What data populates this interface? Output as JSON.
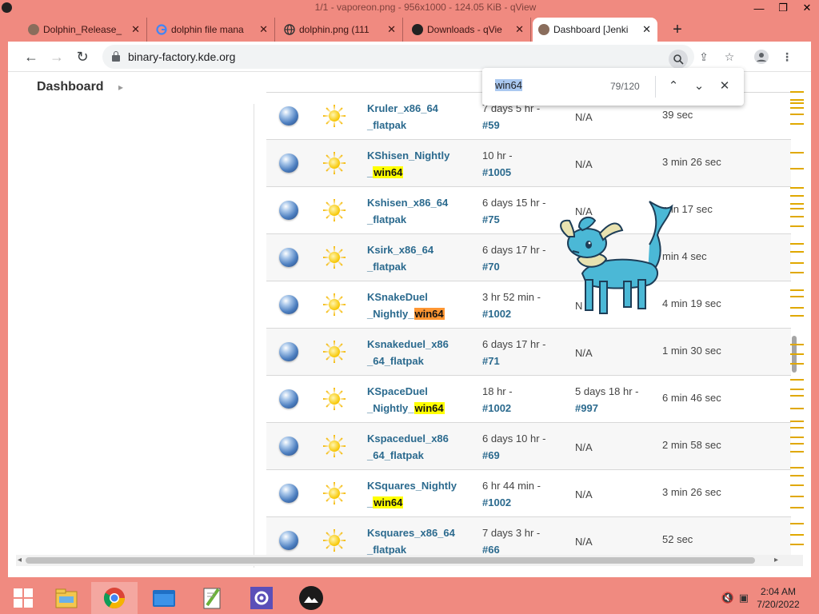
{
  "viewer": {
    "title": "1/1 - vaporeon.png - 956x1000 - 124.05 KiB - qView",
    "controls": [
      "—",
      "❐",
      "✕"
    ]
  },
  "browser": {
    "tabs": [
      {
        "label": "Dolphin_Release_",
        "icon": "avatar-icon",
        "color": "#8a6d5c",
        "close": "✕"
      },
      {
        "label": "dolphin file mana",
        "icon": "google-icon",
        "color": "#4285f4",
        "close": "✕"
      },
      {
        "label": "dolphin.png (111",
        "icon": "dolphin-icon",
        "color": "#333333",
        "close": "✕"
      },
      {
        "label": "Downloads - qVie",
        "icon": "qview-icon",
        "color": "#222222",
        "close": "✕"
      },
      {
        "label": "Dashboard [Jenki",
        "icon": "jenkins-icon",
        "color": "#8a6d5c",
        "close": "✕"
      }
    ],
    "new_tab": "+",
    "url": "binary-factory.kde.org"
  },
  "page": {
    "breadcrumb": "Dashboard",
    "breadcrumb_arrow": "▸"
  },
  "find": {
    "query": "win64",
    "count": "79/120"
  },
  "jobs": [
    {
      "name_parts": [
        [
          "Kruler_x86_64",
          ""
        ],
        [
          "_flatpak",
          ""
        ]
      ],
      "success_time": "7 days 5 hr -",
      "success_build": "#59",
      "fail": "N/A",
      "fail_build": "",
      "duration": "39 sec"
    },
    {
      "name_parts": [
        [
          "KShisen_Nightly",
          ""
        ],
        [
          "_",
          "win64"
        ]
      ],
      "success_time": "10 hr -",
      "success_build": "#1005",
      "fail": "N/A",
      "fail_build": "",
      "duration": "3 min 26 sec"
    },
    {
      "name_parts": [
        [
          "Kshisen_x86_64",
          ""
        ],
        [
          "_flatpak",
          ""
        ]
      ],
      "success_time": "6 days 15 hr -",
      "success_build": "#75",
      "fail": "N/A",
      "fail_build": "",
      "duration": "min 17 sec"
    },
    {
      "name_parts": [
        [
          "Ksirk_x86_64",
          ""
        ],
        [
          "_flatpak",
          ""
        ]
      ],
      "success_time": "6 days 17 hr -",
      "success_build": "#70",
      "fail": "",
      "fail_build": "",
      "duration": "min 4 sec"
    },
    {
      "name_parts": [
        [
          "KSnakeDuel",
          ""
        ],
        [
          "_Nightly_",
          "win64"
        ]
      ],
      "success_time": "3 hr 52 min -",
      "success_build": "#1002",
      "fail": "N",
      "fail_build": "",
      "duration": "4 min 19 sec",
      "current": true
    },
    {
      "name_parts": [
        [
          "Ksnakeduel_x86",
          ""
        ],
        [
          "_64_flatpak",
          ""
        ]
      ],
      "success_time": "6 days 17 hr -",
      "success_build": "#71",
      "fail": "N/A",
      "fail_build": "",
      "duration": "1 min 30 sec"
    },
    {
      "name_parts": [
        [
          "KSpaceDuel",
          ""
        ],
        [
          "_Nightly_",
          "win64"
        ]
      ],
      "success_time": "18 hr -",
      "success_build": "#1002",
      "fail": "5 days 18 hr -",
      "fail_build": "#997",
      "duration": "6 min 46 sec"
    },
    {
      "name_parts": [
        [
          "Kspaceduel_x86",
          ""
        ],
        [
          "_64_flatpak",
          ""
        ]
      ],
      "success_time": "6 days 10 hr -",
      "success_build": "#69",
      "fail": "N/A",
      "fail_build": "",
      "duration": "2 min 58 sec"
    },
    {
      "name_parts": [
        [
          "KSquares_Nightly",
          ""
        ],
        [
          "_",
          "win64"
        ]
      ],
      "success_time": "6 hr 44 min -",
      "success_build": "#1002",
      "fail": "N/A",
      "fail_build": "",
      "duration": "3 min 26 sec"
    },
    {
      "name_parts": [
        [
          "Ksquares_x86_64",
          ""
        ],
        [
          "_flatpak",
          ""
        ]
      ],
      "success_time": "7 days 3 hr -",
      "success_build": "#66",
      "fail": "N/A",
      "fail_build": "",
      "duration": "52 sec"
    }
  ],
  "taskbar": {
    "apps": [
      "start-button",
      "file-explorer",
      "chrome",
      "folder",
      "notepad-plus",
      "settings",
      "qview"
    ],
    "time": "2:04 AM",
    "date": "7/20/2022"
  },
  "colors": {
    "accent": "#f08a80",
    "link": "#2b6a8e",
    "highlight": "#ffff00",
    "current_highlight": "#ff9632"
  }
}
